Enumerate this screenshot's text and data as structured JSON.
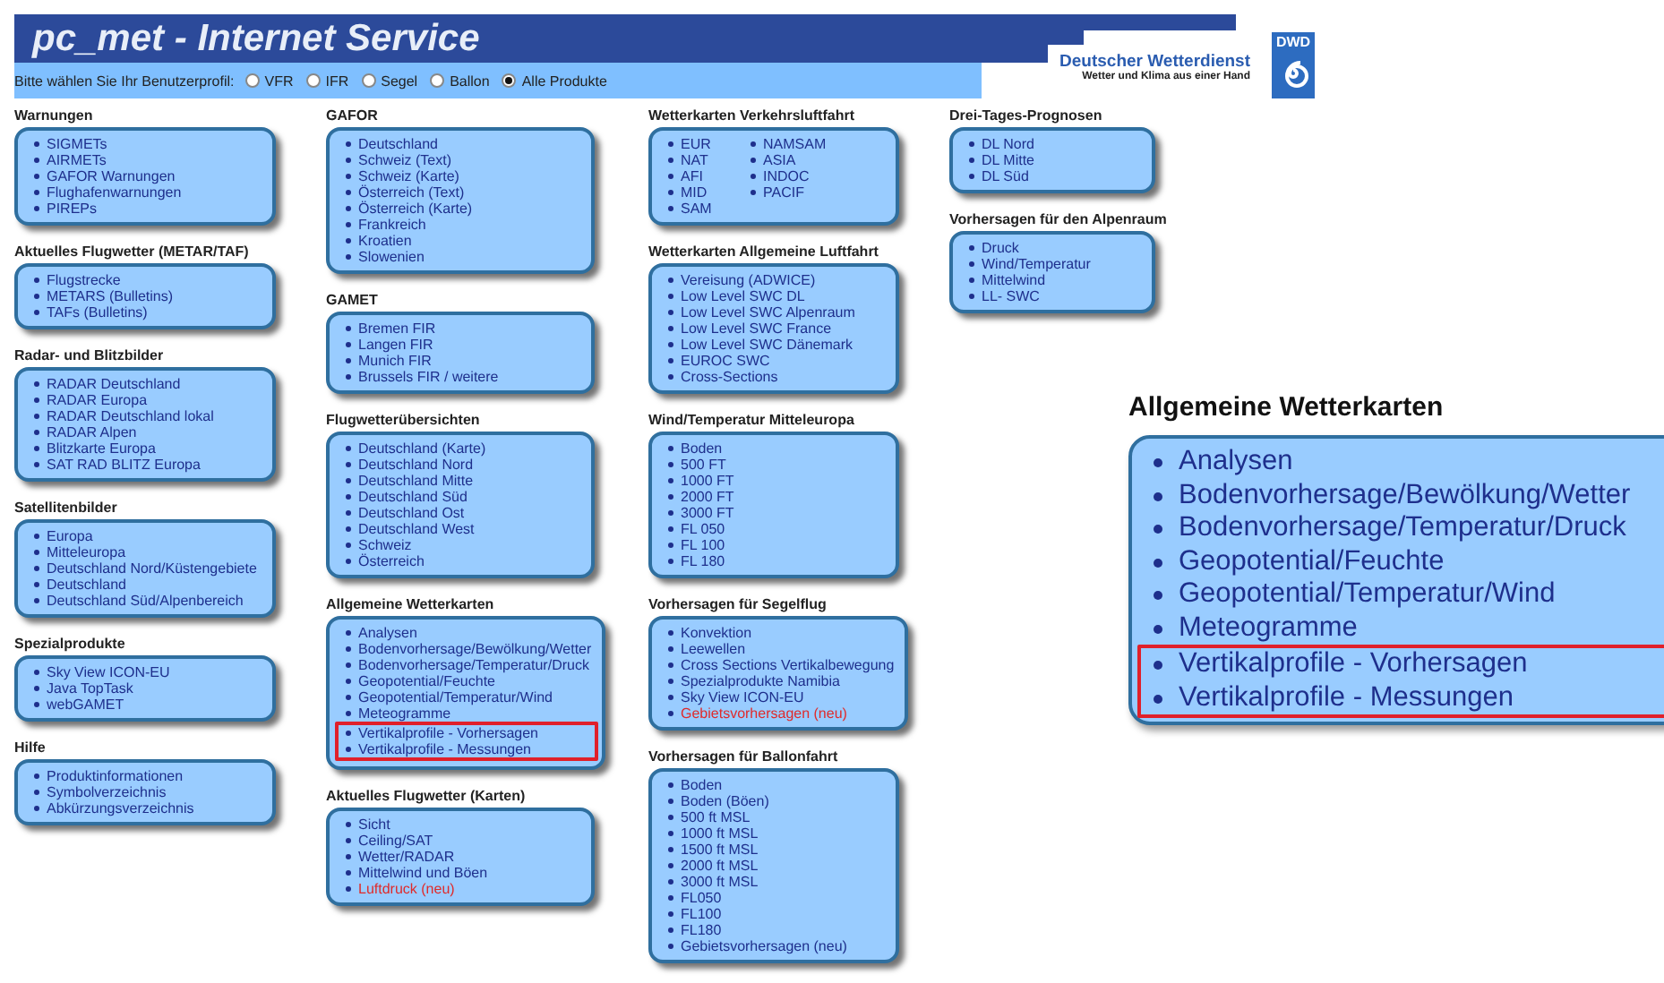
{
  "header": {
    "title": "pc_met - Internet Service",
    "profile_prompt": "Bitte wählen Sie Ihr Benutzerprofil:",
    "profiles": [
      {
        "label": "VFR",
        "selected": false
      },
      {
        "label": "IFR",
        "selected": false
      },
      {
        "label": "Segel",
        "selected": false
      },
      {
        "label": "Ballon",
        "selected": false
      },
      {
        "label": "Alle Produkte",
        "selected": true
      }
    ],
    "logo": {
      "name": "Deutscher Wetterdienst",
      "slogan": "Wetter und Klima aus einer Hand",
      "badge": "DWD"
    }
  },
  "columns": [
    {
      "sections": [
        {
          "heading": "Warnungen",
          "kind": "list",
          "items": [
            {
              "label": "SIGMETs"
            },
            {
              "label": "AIRMETs"
            },
            {
              "label": "GAFOR Warnungen"
            },
            {
              "label": "Flughafenwarnungen"
            },
            {
              "label": "PIREPs"
            }
          ]
        },
        {
          "heading": "Aktuelles Flugwetter (METAR/TAF)",
          "kind": "list",
          "items": [
            {
              "label": "Flugstrecke"
            },
            {
              "label": "METARS (Bulletins)"
            },
            {
              "label": "TAFs (Bulletins)"
            }
          ]
        },
        {
          "heading": "Radar- und Blitzbilder",
          "kind": "list",
          "items": [
            {
              "label": "RADAR Deutschland"
            },
            {
              "label": "RADAR Europa"
            },
            {
              "label": "RADAR Deutschland lokal"
            },
            {
              "label": "RADAR Alpen"
            },
            {
              "label": "Blitzkarte Europa"
            },
            {
              "label": "SAT RAD BLITZ Europa"
            }
          ]
        },
        {
          "heading": "Satellitenbilder",
          "kind": "list",
          "items": [
            {
              "label": "Europa"
            },
            {
              "label": "Mitteleuropa"
            },
            {
              "label": "Deutschland Nord/Küstengebiete"
            },
            {
              "label": "Deutschland"
            },
            {
              "label": "Deutschland Süd/Alpenbereich"
            }
          ]
        },
        {
          "heading": "Spezialprodukte",
          "kind": "list",
          "items": [
            {
              "label": "Sky View ICON-EU"
            },
            {
              "label": "Java TopTask"
            },
            {
              "label": "webGAMET"
            }
          ]
        },
        {
          "heading": "Hilfe",
          "kind": "list",
          "items": [
            {
              "label": "Produktinformationen"
            },
            {
              "label": "Symbolverzeichnis"
            },
            {
              "label": "Abkürzungsverzeichnis"
            }
          ]
        }
      ]
    },
    {
      "sections": [
        {
          "heading": "GAFOR",
          "kind": "list",
          "items": [
            {
              "label": "Deutschland"
            },
            {
              "label": "Schweiz (Text)"
            },
            {
              "label": "Schweiz (Karte)"
            },
            {
              "label": "Österreich (Text)"
            },
            {
              "label": "Österreich (Karte)"
            },
            {
              "label": "Frankreich"
            },
            {
              "label": "Kroatien"
            },
            {
              "label": "Slowenien"
            }
          ]
        },
        {
          "heading": "GAMET",
          "kind": "list",
          "items": [
            {
              "label": "Bremen FIR"
            },
            {
              "label": "Langen FIR"
            },
            {
              "label": "Munich FIR"
            },
            {
              "label": "Brussels FIR / weitere"
            }
          ]
        },
        {
          "heading": "Flugwetterübersichten",
          "kind": "list",
          "items": [
            {
              "label": "Deutschland (Karte)"
            },
            {
              "label": "Deutschland Nord"
            },
            {
              "label": "Deutschland Mitte"
            },
            {
              "label": "Deutschland Süd"
            },
            {
              "label": "Deutschland Ost"
            },
            {
              "label": "Deutschland West"
            },
            {
              "label": "Schweiz"
            },
            {
              "label": "Österreich"
            }
          ]
        },
        {
          "heading": "Allgemeine Wetterkarten",
          "kind": "list",
          "items": [
            {
              "label": "Analysen"
            },
            {
              "label": "Bodenvorhersage/Bewölkung/Wetter"
            },
            {
              "label": "Bodenvorhersage/Temperatur/Druck"
            },
            {
              "label": "Geopotential/Feuchte"
            },
            {
              "label": "Geopotential/Temperatur/Wind"
            },
            {
              "label": "Meteogramme"
            },
            {
              "label": "Vertikalprofile - Vorhersagen",
              "highlighted": true
            },
            {
              "label": "Vertikalprofile - Messungen",
              "highlighted": true
            }
          ]
        },
        {
          "heading": "Aktuelles Flugwetter (Karten)",
          "kind": "list",
          "items": [
            {
              "label": "Sicht"
            },
            {
              "label": "Ceiling/SAT"
            },
            {
              "label": "Wetter/RADAR"
            },
            {
              "label": "Mittelwind und Böen"
            },
            {
              "label": "Luftdruck (neu)",
              "new": true
            }
          ]
        }
      ]
    },
    {
      "sections": [
        {
          "heading": "Wetterkarten Verkehrsluftfahrt",
          "kind": "two-column",
          "items": [
            {
              "label": "EUR"
            },
            {
              "label": "NAT"
            },
            {
              "label": "AFI"
            },
            {
              "label": "MID"
            },
            {
              "label": "SAM"
            },
            {
              "label": "NAMSAM"
            },
            {
              "label": "ASIA"
            },
            {
              "label": "INDOC"
            },
            {
              "label": "PACIF"
            }
          ]
        },
        {
          "heading": "Wetterkarten Allgemeine Luftfahrt",
          "kind": "list",
          "items": [
            {
              "label": "Vereisung (ADWICE)"
            },
            {
              "label": "Low Level SWC DL"
            },
            {
              "label": "Low Level SWC Alpenraum"
            },
            {
              "label": "Low Level SWC France"
            },
            {
              "label": "Low Level SWC Dänemark"
            },
            {
              "label": "EUROC SWC"
            },
            {
              "label": "Cross-Sections"
            }
          ]
        },
        {
          "heading": "Wind/Temperatur Mitteleuropa",
          "kind": "list",
          "items": [
            {
              "label": "Boden"
            },
            {
              "label": "500 FT"
            },
            {
              "label": "1000 FT"
            },
            {
              "label": "2000 FT"
            },
            {
              "label": "3000 FT"
            },
            {
              "label": "FL 050"
            },
            {
              "label": "FL 100"
            },
            {
              "label": "FL 180"
            }
          ]
        },
        {
          "heading": "Vorhersagen für Segelflug",
          "kind": "list",
          "items": [
            {
              "label": "Konvektion"
            },
            {
              "label": "Leewellen"
            },
            {
              "label": "Cross Sections Vertikalbewegung"
            },
            {
              "label": "Spezialprodukte Namibia"
            },
            {
              "label": "Sky View ICON-EU"
            },
            {
              "label": "Gebietsvorhersagen (neu)",
              "new": true
            }
          ]
        },
        {
          "heading": "Vorhersagen für Ballonfahrt",
          "kind": "list",
          "items": [
            {
              "label": "Boden"
            },
            {
              "label": "Boden (Böen)"
            },
            {
              "label": "500 ft MSL"
            },
            {
              "label": "1000 ft MSL"
            },
            {
              "label": "1500 ft MSL"
            },
            {
              "label": "2000 ft MSL"
            },
            {
              "label": "3000 ft MSL"
            },
            {
              "label": "FL050"
            },
            {
              "label": "FL100"
            },
            {
              "label": "FL180"
            },
            {
              "label": "Gebietsvorhersagen (neu)"
            }
          ]
        }
      ]
    },
    {
      "sections": [
        {
          "heading": "Drei-Tages-Prognosen",
          "kind": "list",
          "items": [
            {
              "label": "DL Nord"
            },
            {
              "label": "DL Mitte"
            },
            {
              "label": "DL Süd"
            }
          ]
        },
        {
          "heading": "Vorhersagen für den Alpenraum",
          "kind": "list",
          "items": [
            {
              "label": "Druck"
            },
            {
              "label": "Wind/Temperatur"
            },
            {
              "label": "Mittelwind"
            },
            {
              "label": "LL- SWC"
            }
          ]
        }
      ]
    }
  ],
  "zoom_inset": {
    "heading": "Allgemeine Wetterkarten",
    "items": [
      {
        "label": "Analysen"
      },
      {
        "label": "Bodenvorhersage/Bewölkung/Wetter"
      },
      {
        "label": "Bodenvorhersage/Temperatur/Druck"
      },
      {
        "label": "Geopotential/Feuchte"
      },
      {
        "label": "Geopotential/Temperatur/Wind"
      },
      {
        "label": "Meteogramme"
      },
      {
        "label": "Vertikalprofile - Vorhersagen",
        "highlighted": true
      },
      {
        "label": "Vertikalprofile - Messungen",
        "highlighted": true
      }
    ]
  }
}
